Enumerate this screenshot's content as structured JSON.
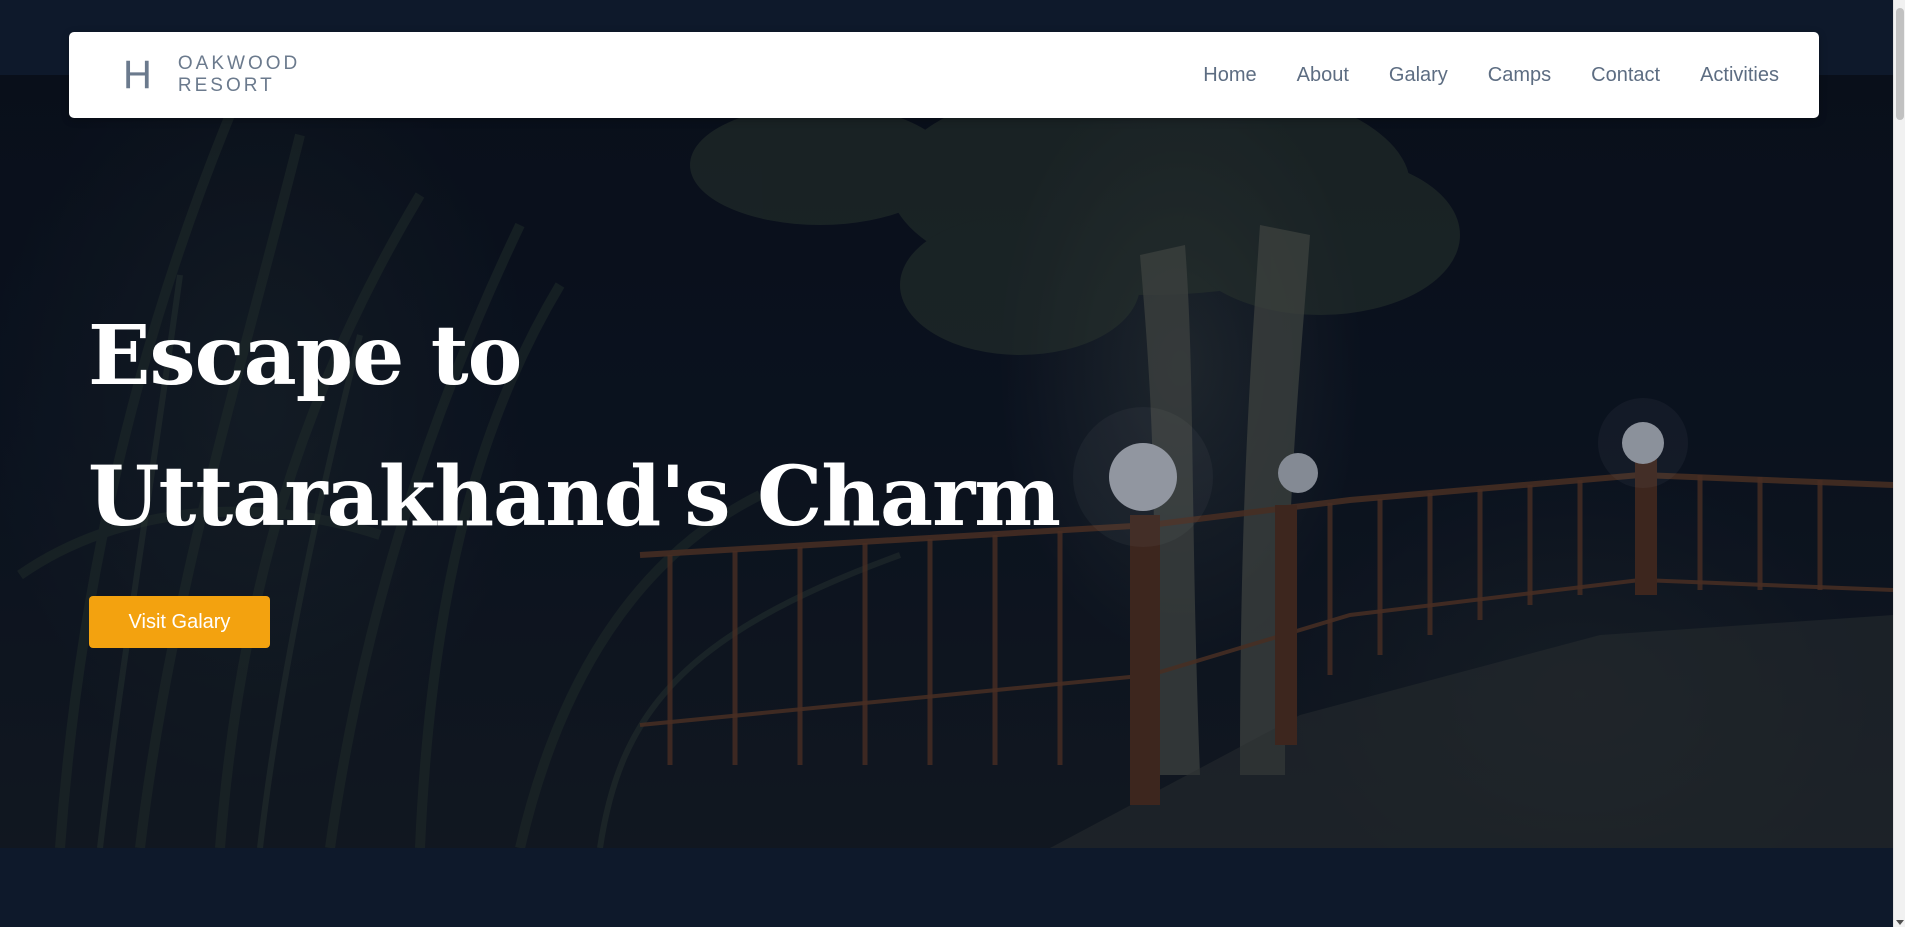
{
  "brand": {
    "mark": "H",
    "line1": "OAKWOOD",
    "line2": "RESORT"
  },
  "nav": {
    "items": [
      {
        "label": "Home"
      },
      {
        "label": "About"
      },
      {
        "label": "Galary"
      },
      {
        "label": "Camps"
      },
      {
        "label": "Contact"
      },
      {
        "label": "Activities"
      }
    ]
  },
  "hero": {
    "title_line1": "Escape to",
    "title_line2": "Uttarakhand's Charm",
    "cta_label": "Visit Galary"
  },
  "colors": {
    "page_background": "#0e192b",
    "navbar_background": "#ffffff",
    "nav_text": "#5d6d82",
    "cta_background": "#f3a20f",
    "hero_text": "#ffffff"
  }
}
